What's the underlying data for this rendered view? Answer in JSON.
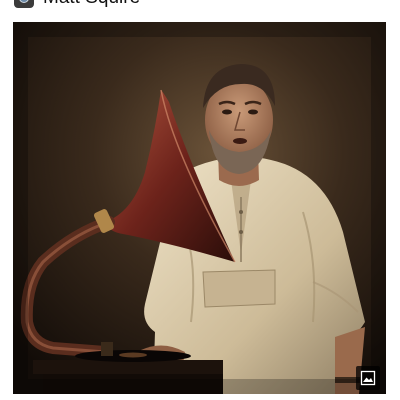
{
  "post": {
    "author": {
      "name": "Matt Squire",
      "avatar_icon": "camera-icon"
    },
    "photo": {
      "badge_icon": "image-icon"
    }
  },
  "colors": {
    "background": "#ffffff",
    "text": "#111111",
    "photo_dark": "#2a1f16",
    "shirt": "#d8c9a8",
    "horn": "#7a2c22"
  }
}
